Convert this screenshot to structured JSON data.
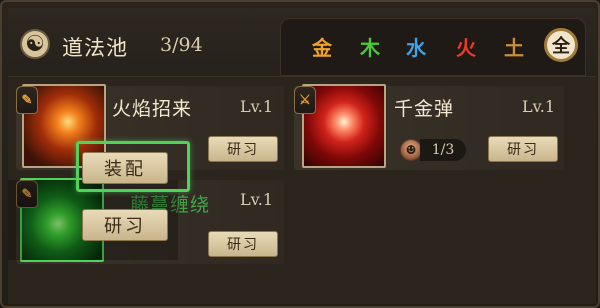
{
  "header": {
    "title": "道法池",
    "count": "3/94"
  },
  "element_tabs": [
    {
      "label": "金",
      "color": "#f0a22a"
    },
    {
      "label": "木",
      "color": "#4cc93c"
    },
    {
      "label": "水",
      "color": "#3ea3e8"
    },
    {
      "label": "火",
      "color": "#ea3b2b"
    },
    {
      "label": "土",
      "color": "#c98d3b"
    },
    {
      "label": "全",
      "color": "#2b2117"
    }
  ],
  "cards": [
    {
      "name": "火焰招来",
      "level": "Lv.1",
      "button": "研习",
      "image": "fire-skill",
      "badge_icon": "scroll-icon"
    },
    {
      "name": "千金弹",
      "level": "Lv.1",
      "button": "研习",
      "image": "coin-bullet-skill",
      "badge_icon": "sword-icon",
      "fragment_count": "1/3"
    },
    {
      "name": "藤蔓缠绕",
      "level": "Lv.1",
      "button": "研习",
      "image": "vine-skill",
      "badge_icon": "scroll-icon"
    }
  ],
  "popup": {
    "equip_label": "装配",
    "study_label": "研习"
  }
}
